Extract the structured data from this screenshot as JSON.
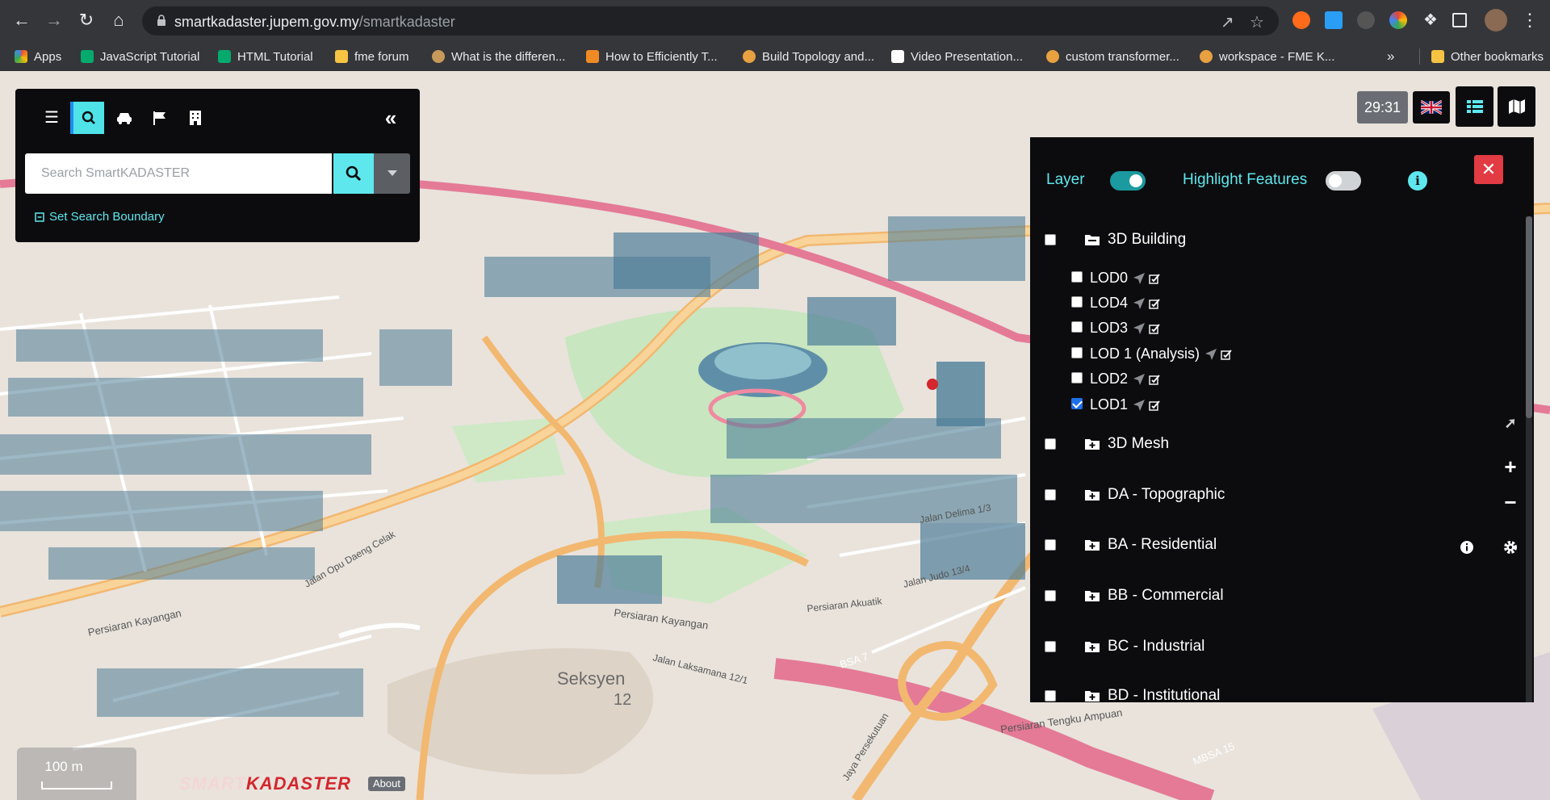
{
  "browser": {
    "url_domain": "smartkadaster.jupem.gov.my",
    "url_path": "/smartkadaster",
    "bookmarks": [
      {
        "label": "Apps",
        "color": "#4285f4"
      },
      {
        "label": "JavaScript Tutorial",
        "color": "#04aa6d"
      },
      {
        "label": "HTML Tutorial",
        "color": "#04aa6d"
      },
      {
        "label": "fme forum",
        "color": "#f6c343"
      },
      {
        "label": "What is the differen...",
        "color": "#e0a050"
      },
      {
        "label": "How to Efficiently T...",
        "color": "#f08a24"
      },
      {
        "label": "Build Topology and...",
        "color": "#e8a040"
      },
      {
        "label": "Video Presentation...",
        "color": "#ffffff"
      },
      {
        "label": "custom transformer...",
        "color": "#e8a040"
      },
      {
        "label": "workspace - FME K...",
        "color": "#e8a040"
      }
    ],
    "overflow": "»",
    "other_bookmarks": "Other bookmarks"
  },
  "search": {
    "placeholder": "Search SmartKADASTER",
    "boundary_link": "Set Search Boundary"
  },
  "toolbar": {
    "clock": "29:31"
  },
  "layer_panel": {
    "layer_label": "Layer",
    "layer_on": true,
    "highlight_label": "Highlight Features",
    "highlight_on": false,
    "close": "✕",
    "groups": [
      {
        "label": "3D Building",
        "checked": false,
        "expanded": true
      },
      {
        "label": "3D Mesh",
        "checked": false,
        "expanded": false
      },
      {
        "label": "DA - Topographic",
        "checked": false,
        "expanded": false
      },
      {
        "label": "BA - Residential",
        "checked": false,
        "expanded": false
      },
      {
        "label": "BB - Commercial",
        "checked": false,
        "expanded": false
      },
      {
        "label": "BC - Industrial",
        "checked": false,
        "expanded": false
      },
      {
        "label": "BD - Institutional",
        "checked": false,
        "expanded": false
      }
    ],
    "sublayers": [
      {
        "label": "LOD0",
        "checked": false
      },
      {
        "label": "LOD4",
        "checked": false
      },
      {
        "label": "LOD3",
        "checked": false
      },
      {
        "label": "LOD 1 (Analysis)",
        "checked": false
      },
      {
        "label": "LOD2",
        "checked": false
      },
      {
        "label": "LOD1",
        "checked": true
      }
    ]
  },
  "map": {
    "labels": {
      "seksyen": "Seksyen",
      "seksyen_no": "12",
      "persiaran_kayangan": "Persiaran Kayangan",
      "persiaran_kayangan_left": "Persiaran Kayangan",
      "jalan_laksamana": "Jalan Laksamana 12/1",
      "persiaran_akuatik": "Persiaran Akuatik",
      "jalan_judo": "Jalan Judo 13/4",
      "persiaran_tengku_ampuan": "Persiaran Tengku Ampuan",
      "bsa7": "BSA 7",
      "mbsa15": "MBSA 15",
      "jalan_opu": "Jalan Opu Daeng Celak",
      "jalan_delima": "Jalan Delima 1/3",
      "persekutuan": "Jaya Persekutuan"
    },
    "scale_label": "100 m",
    "logo_part1": "SMART",
    "logo_part2": "KADASTER",
    "about": "About"
  }
}
